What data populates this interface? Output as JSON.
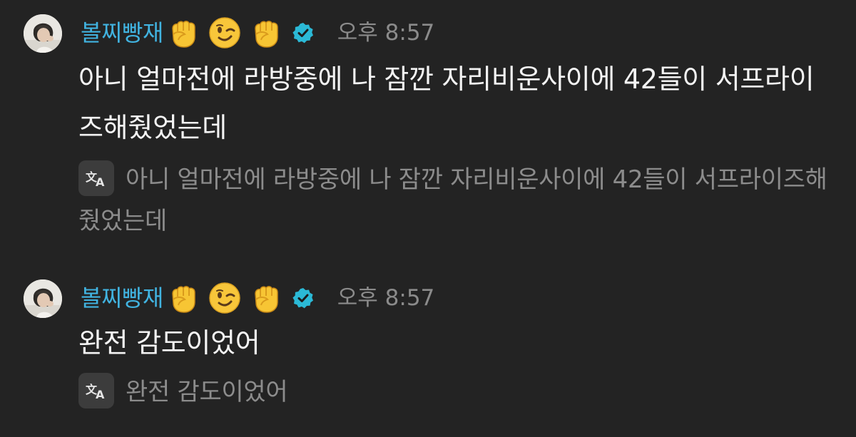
{
  "messages": [
    {
      "username": "볼찌빵재",
      "time": "오후 8:57",
      "text": "아니 얼마전에 라방중에 나 잠깐 자리비운사이에 42들이 서프라이즈해줬었는데",
      "translation": "아니 얼마전에 라방중에 나 잠깐 자리비운사이에 42들이 서프라이즈해줬었는데",
      "emojis": [
        "raised-fist",
        "winking-face",
        "raised-fist"
      ],
      "verified_icon": "verified-badge-icon",
      "translate_icon": "translate-icon"
    },
    {
      "username": "볼찌빵재",
      "time": "오후 8:57",
      "text": "완전 감도이었어",
      "translation": "완전 감도이었어",
      "emojis": [
        "raised-fist",
        "winking-face",
        "raised-fist"
      ],
      "verified_icon": "verified-badge-icon",
      "translate_icon": "translate-icon"
    }
  ],
  "colors": {
    "background": "#232323",
    "username": "#41b3e0",
    "time": "#8b8b8b",
    "message_text": "#f4f4f4",
    "translation_text": "#8c8c8c",
    "verified": "#2bb9d6"
  }
}
